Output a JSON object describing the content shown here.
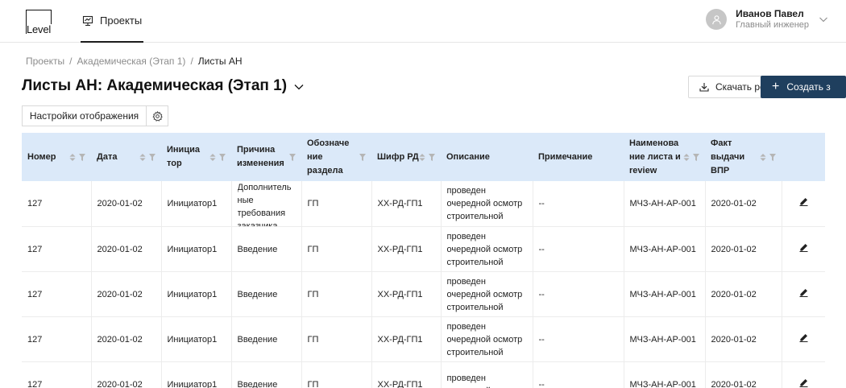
{
  "header": {
    "logo_text": "Level",
    "nav_projects": "Проекты",
    "user_name": "Иванов Павел",
    "user_role": "Главный инженер"
  },
  "breadcrumb": {
    "items": [
      "Проекты",
      "Академическая (Этап 1)",
      "Листы АН"
    ],
    "separator": "/"
  },
  "page": {
    "title": "Листы АН: Академическая (Этап 1)",
    "download_label": "Скачать ре",
    "create_label": "Создать з",
    "settings_label": "Настройки отображения"
  },
  "table": {
    "headers": {
      "number": "Номер",
      "date": "Дата",
      "initiator": "Инициа тор",
      "reason": "Причина изменения",
      "section": "Обозначе ние раздела",
      "code": "Шифр РД",
      "description": "Описание",
      "note": "Примечание",
      "sheet_name": "Наименова ние листа и review",
      "issue_date": "Факт выдачи ВПР"
    },
    "rows": [
      {
        "number": "127",
        "date": "2020-01-02",
        "initiator": "Инициатор1",
        "reason": "Дополнитель ные требования заказчика",
        "section": "ГП",
        "code": "ХХ-РД-ГП1",
        "description": "проведен очередной осмотр строительной",
        "note": "--",
        "sheet_name": "МЧЗ-АН-АР-001",
        "issue_date": "2020-01-02"
      },
      {
        "number": "127",
        "date": "2020-01-02",
        "initiator": "Инициатор1",
        "reason": "Введение",
        "section": "ГП",
        "code": "ХХ-РД-ГП1",
        "description": "проведен очередной осмотр строительной",
        "note": "--",
        "sheet_name": "МЧЗ-АН-АР-001",
        "issue_date": "2020-01-02"
      },
      {
        "number": "127",
        "date": "2020-01-02",
        "initiator": "Инициатор1",
        "reason": "Введение",
        "section": "ГП",
        "code": "ХХ-РД-ГП1",
        "description": "проведен очередной осмотр строительной",
        "note": "--",
        "sheet_name": "МЧЗ-АН-АР-001",
        "issue_date": "2020-01-02"
      },
      {
        "number": "127",
        "date": "2020-01-02",
        "initiator": "Инициатор1",
        "reason": "Введение",
        "section": "ГП",
        "code": "ХХ-РД-ГП1",
        "description": "проведен очередной осмотр строительной",
        "note": "--",
        "sheet_name": "МЧЗ-АН-АР-001",
        "issue_date": "2020-01-02"
      },
      {
        "number": "127",
        "date": "2020-01-02",
        "initiator": "Инициатор1",
        "reason": "Введение",
        "section": "ГП",
        "code": "ХХ-РД-ГП1",
        "description": "проведен очередной осмотр",
        "note": "--",
        "sheet_name": "МЧЗ-АН-АР-001",
        "issue_date": "2020-01-02"
      }
    ]
  },
  "icons": {
    "nav": "presentation-icon",
    "avatar": "user-icon",
    "chevron": "chevron-down-icon",
    "download": "download-icon",
    "gear": "gear-icon",
    "sort": "sort-icon",
    "filter": "filter-icon",
    "edit": "pencil-icon"
  },
  "colors": {
    "header_bg": "#dbe9f9",
    "primary_button": "#1f3f5e",
    "avatar_bg": "#c6c6c6"
  }
}
